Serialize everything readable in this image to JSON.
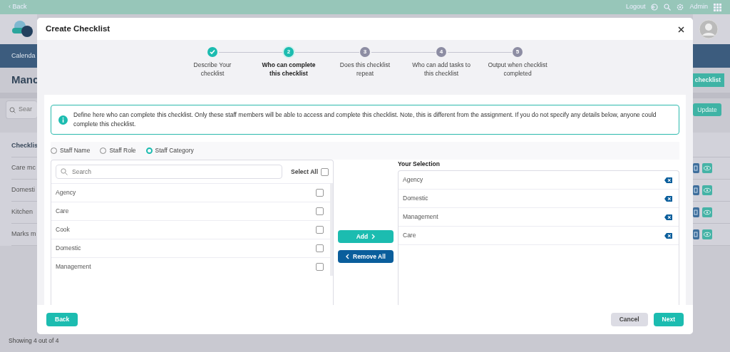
{
  "top_bar": {
    "back": "‹ Back",
    "logout": "Logout",
    "user": "Admin"
  },
  "background": {
    "nav_item": "Calenda",
    "page_title": "Manc",
    "search_placeholder": "Sear",
    "add_button": "checklist",
    "update_button": "Update",
    "list_header": "Checklis",
    "rows": [
      "Care mc",
      "Domesti",
      "Kitchen",
      "Marks m"
    ],
    "footer": "Showing 4 out of 4"
  },
  "modal": {
    "title": "Create Checklist",
    "steps": [
      {
        "label": "Describe Your checklist",
        "completed": true,
        "selected": false
      },
      {
        "number": "2",
        "label": "Who can complete this checklist",
        "completed": false,
        "selected": true
      },
      {
        "number": "3",
        "label": "Does this checklist repeat",
        "completed": false,
        "selected": false
      },
      {
        "number": "4",
        "label": "Who can add tasks to this checklist",
        "completed": false,
        "selected": false
      },
      {
        "number": "5",
        "label": "Output when checklist completed",
        "completed": false,
        "selected": false
      }
    ],
    "info": "Define here who can complete this checklist. Only these staff members will be able to access and complete this checklist. Note, this is different from the assignment. If you do not specify any details below, anyone could complete this checklist.",
    "filters": [
      {
        "label": "Staff Name",
        "selected": false
      },
      {
        "label": "Staff Role",
        "selected": false
      },
      {
        "label": "Staff Category",
        "selected": true
      }
    ],
    "search": {
      "placeholder": "Search"
    },
    "select_all": {
      "label": "Select All",
      "checked": false
    },
    "available": [
      {
        "label": "Agency",
        "checked": false
      },
      {
        "label": "Care",
        "checked": false
      },
      {
        "label": "Cook",
        "checked": false
      },
      {
        "label": "Domestic",
        "checked": false
      },
      {
        "label": "Management",
        "checked": false
      }
    ],
    "add_button": "Add",
    "remove_all_button": "Remove All",
    "selection_title": "Your Selection",
    "selected": [
      "Agency",
      "Domestic",
      "Management",
      "Care"
    ],
    "footer_buttons": {
      "back": "Back",
      "cancel": "Cancel",
      "next": "Next"
    }
  }
}
